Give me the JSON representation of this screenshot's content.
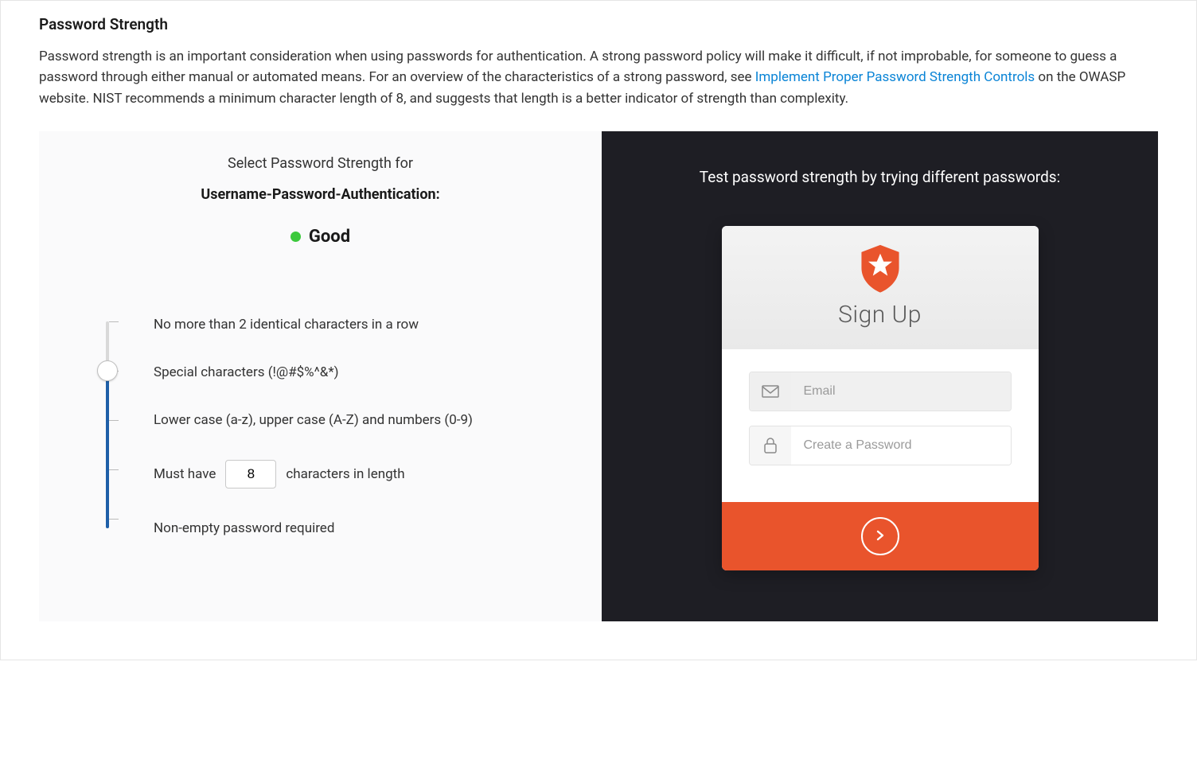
{
  "section": {
    "title": "Password Strength",
    "intro_before_link": "Password strength is an important consideration when using passwords for authentication. A strong password policy will make it difficult, if not improbable, for someone to guess a password through either manual or automated means. For an overview of the characteristics of a strong password, see ",
    "link_text": "Implement Proper Password Strength Controls",
    "intro_after_link": " on the OWASP website. NIST recommends a minimum character length of 8, and suggests that length is a better indicator of strength than complexity."
  },
  "config": {
    "select_heading": "Select Password Strength for",
    "connection_label": "Username-Password-Authentication:",
    "strength_level": "Good",
    "rules": {
      "identical": "No more than 2 identical characters in a row",
      "special": "Special characters (!@#$%^&*)",
      "cases": "Lower case (a-z), upper case (A-Z) and numbers (0-9)",
      "length_prefix": "Must have",
      "length_value": "8",
      "length_suffix": "characters in length",
      "nonempty": "Non-empty password required"
    }
  },
  "preview": {
    "prompt": "Test password strength by trying different passwords:",
    "card_title": "Sign Up",
    "email_placeholder": "Email",
    "password_placeholder": "Create a Password"
  }
}
